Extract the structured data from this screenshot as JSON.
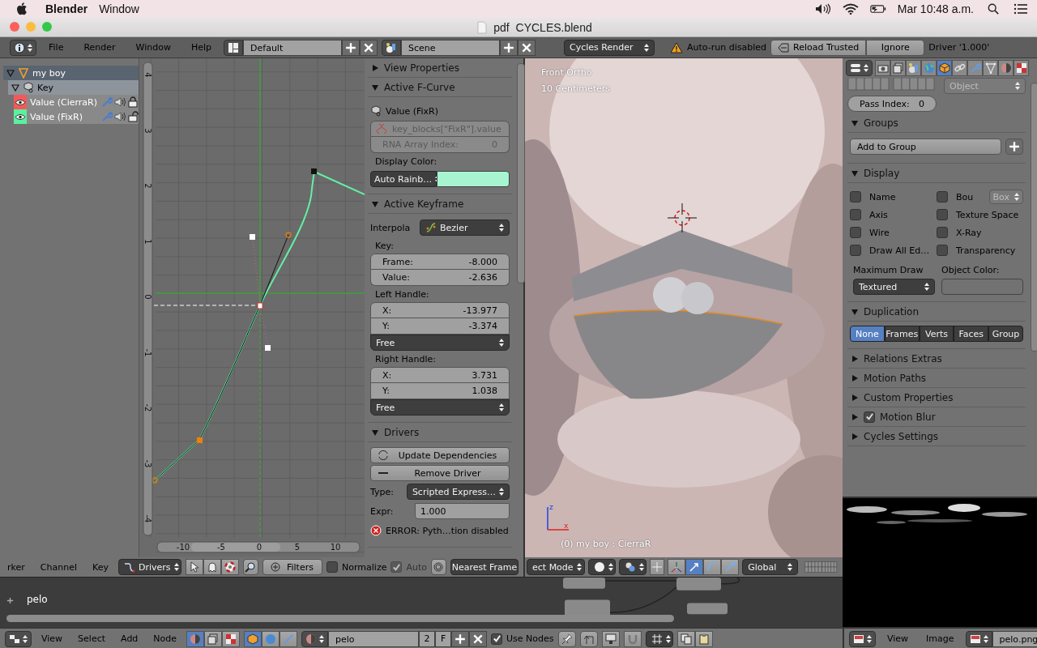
{
  "menubar": {
    "app": "Blender",
    "items": [
      "Window"
    ],
    "clock": "Mar 10:48 a.m."
  },
  "window": {
    "title": "pdf  CYCLES.blend"
  },
  "info_header": {
    "menus": [
      "File",
      "Render",
      "Window",
      "Help"
    ],
    "layout": "Default",
    "scene": "Scene",
    "engine": "Cycles Render",
    "warning": "Auto-run disabled",
    "buttons": [
      "Reload Trusted",
      "Ignore"
    ],
    "report": "Driver '1.000'"
  },
  "channels": [
    {
      "name": "my boy",
      "kind": "object",
      "expanded": true,
      "children": [
        {
          "name": "Key",
          "kind": "key",
          "expanded": true,
          "children": [
            {
              "name": "Value (CierraR)",
              "color": "#f25a5a",
              "locked": true
            },
            {
              "name": "Value (FixR)",
              "color": "#5af0a0",
              "locked": false
            }
          ]
        }
      ]
    }
  ],
  "graph": {
    "y_labels": [
      "4",
      "3",
      "2",
      "1",
      "0",
      "-1",
      "-2",
      "-3",
      "-4"
    ],
    "x_labels": [
      "-10",
      "-5",
      "0",
      "5",
      "10"
    ]
  },
  "active_fcurve": {
    "collapsed_title": "View Properties",
    "title": "Active F-Curve",
    "expanded": true,
    "channel": "Value (FixR)",
    "path": "key_blocks[\"FixR\"].value",
    "index_label": "RNA Array Index:",
    "index": "0",
    "color_label": "Display Color:",
    "color_mode": "Auto Rainb…",
    "color": "#a6f5d0"
  },
  "active_keyframe": {
    "title": "Active Keyframe",
    "expanded": true,
    "interpolation_label": "Interpola",
    "interpolation": "Bezier",
    "groups": [
      {
        "label": "Key:",
        "fields": [
          {
            "label": "Frame:",
            "value": "-8.000"
          },
          {
            "label": "Value:",
            "value": "-2.636"
          }
        ]
      },
      {
        "label": "Left Handle:",
        "fields": [
          {
            "label": "X:",
            "value": "-13.977"
          },
          {
            "label": "Y:",
            "value": "-3.374"
          }
        ],
        "handle_type": "Free"
      },
      {
        "label": "Right Handle:",
        "fields": [
          {
            "label": "X:",
            "value": "3.731"
          },
          {
            "label": "Y:",
            "value": "1.038"
          }
        ],
        "handle_type": "Free"
      }
    ]
  },
  "drivers": {
    "title": "Drivers",
    "expanded": true,
    "buttons": [
      "Update Dependencies",
      "Remove Driver"
    ],
    "type_label": "Type:",
    "type": "Scripted Express…",
    "expr_label": "Expr:",
    "expr": "1.000",
    "error": "ERROR: Pyth…tion disabled"
  },
  "graph_header": {
    "menus": [
      "rker",
      "Channel",
      "Key"
    ],
    "mode": "Drivers",
    "filters": "Filters",
    "normalize": {
      "label": "Normalize",
      "checked": false
    },
    "auto": {
      "label": "Auto",
      "checked": true,
      "disabled": true
    },
    "snap": "Nearest Frame"
  },
  "viewport": {
    "view": "Front Ortho",
    "scale": "10 Centimeters",
    "object": "(0) my boy : CierraR",
    "axes": [
      "z",
      "x"
    ]
  },
  "viewport_header": {
    "mode": "ect Mode",
    "orientation": "Global"
  },
  "properties": {
    "tabs": [
      {
        "kind": "render",
        "selected": false
      },
      {
        "kind": "layers",
        "selected": false
      },
      {
        "kind": "scene",
        "selected": false
      },
      {
        "kind": "world",
        "selected": false
      },
      {
        "kind": "object",
        "selected": true
      },
      {
        "kind": "constraints",
        "selected": false
      },
      {
        "kind": "modifiers",
        "selected": false
      },
      {
        "kind": "data",
        "selected": false
      },
      {
        "kind": "material",
        "selected": false
      },
      {
        "kind": "texture",
        "selected": false
      }
    ],
    "parent_type": "Object",
    "pass_label": "Pass Index:",
    "pass_index": "0",
    "groups": {
      "title": "Groups",
      "expanded": true,
      "button": "Add to Group"
    },
    "display": {
      "title": "Display",
      "expanded": true,
      "options": [
        {
          "label": "Name",
          "checked": false
        },
        {
          "label": "Bou",
          "checked": false,
          "dropdown": "Box"
        },
        {
          "label": "Axis",
          "checked": false
        },
        {
          "label": "Texture Space",
          "checked": false
        },
        {
          "label": "Wire",
          "checked": false
        },
        {
          "label": "X-Ray",
          "checked": false
        },
        {
          "label": "Draw All Ed…",
          "checked": false
        },
        {
          "label": "Transparency",
          "checked": false
        }
      ],
      "max_draw_label": "Maximum Draw",
      "max_draw": "Textured",
      "color_label": "Object Color:"
    },
    "duplication": {
      "title": "Duplication",
      "expanded": true,
      "options": [
        {
          "label": "None",
          "selected": true
        },
        {
          "label": "Frames",
          "selected": false
        },
        {
          "label": "Verts",
          "selected": false
        },
        {
          "label": "Faces",
          "selected": false
        },
        {
          "label": "Group",
          "selected": false
        }
      ]
    },
    "panels": [
      {
        "title": "Relations Extras",
        "expanded": false
      },
      {
        "title": "Motion Paths",
        "expanded": false
      },
      {
        "title": "Custom Properties",
        "expanded": false
      },
      {
        "title": "Motion Blur",
        "expanded": false,
        "checked": true
      },
      {
        "title": "Cycles Settings",
        "expanded": false
      }
    ]
  },
  "node_editor": {
    "label": "pelo"
  },
  "node_header": {
    "menus": [
      "View",
      "Select",
      "Add",
      "Node"
    ],
    "material": "pelo",
    "users": "2",
    "fake_user": "F",
    "use_nodes": {
      "label": "Use Nodes",
      "checked": true
    }
  },
  "image_header": {
    "menus": [
      "View",
      "Image"
    ],
    "image": "pelo.png"
  }
}
